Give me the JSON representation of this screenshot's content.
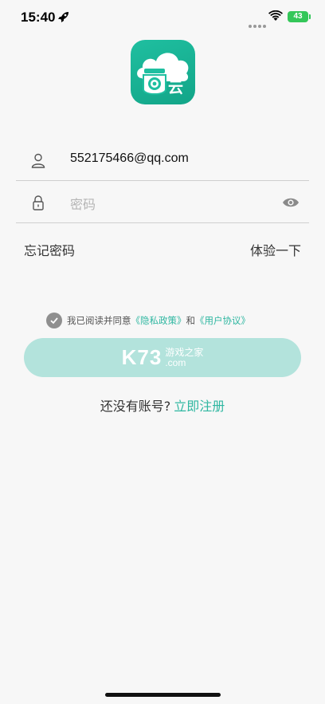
{
  "status_bar": {
    "time": "15:40",
    "battery_level": "43"
  },
  "login_form": {
    "email_value": "552175466@qq.com",
    "password_placeholder": "密码"
  },
  "links": {
    "forgot_password": "忘记密码",
    "try_it": "体验一下"
  },
  "agreement": {
    "prefix": "我已阅读并同意",
    "privacy_policy": "《隐私政策》",
    "and": "和",
    "user_agreement": "《用户协议》",
    "checked": true
  },
  "watermark": {
    "main": "K73",
    "line1": "游戏之家",
    "line2": ".com"
  },
  "register": {
    "question": "还没有账号?",
    "link": "立即注册"
  },
  "colors": {
    "accent": "#2fb7a1",
    "button_disabled": "#b3e3dc",
    "logo_bg": "#1fbfa0",
    "battery": "#34c759"
  }
}
